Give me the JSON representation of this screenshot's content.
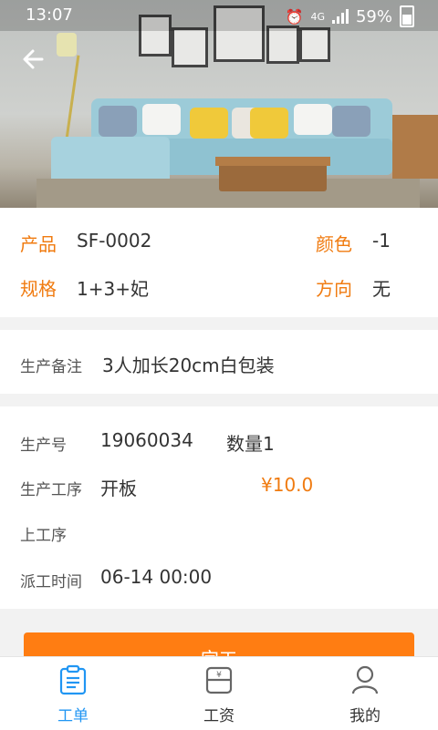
{
  "status_bar": {
    "time": "13:07",
    "network": "4G",
    "battery": "59%"
  },
  "product": {
    "product_label": "产品",
    "product_value": "SF-0002",
    "color_label": "颜色",
    "color_value": "-1",
    "spec_label": "规格",
    "spec_value": "1+3+妃",
    "direction_label": "方向",
    "direction_value": "无"
  },
  "remark": {
    "label": "生产备注",
    "value": "3人加长20cm白包装"
  },
  "production": {
    "number_label": "生产号",
    "number_value": "19060034",
    "quantity_text": "数量1",
    "process_label": "生产工序",
    "process_value": "开板",
    "price": "¥10.0",
    "prev_process_label": "上工序",
    "dispatch_label": "派工时间",
    "dispatch_value": "06-14 00:00"
  },
  "action_button": {
    "label": "完工"
  },
  "bottom_nav": {
    "tabs": [
      {
        "label": "工单",
        "icon": "clipboard-icon",
        "active": true
      },
      {
        "label": "工资",
        "icon": "wallet-icon",
        "active": false
      },
      {
        "label": "我的",
        "icon": "person-icon",
        "active": false
      }
    ]
  },
  "colors": {
    "accent": "#f07b10",
    "active_tab": "#2196f3",
    "button": "#ff7d12"
  }
}
